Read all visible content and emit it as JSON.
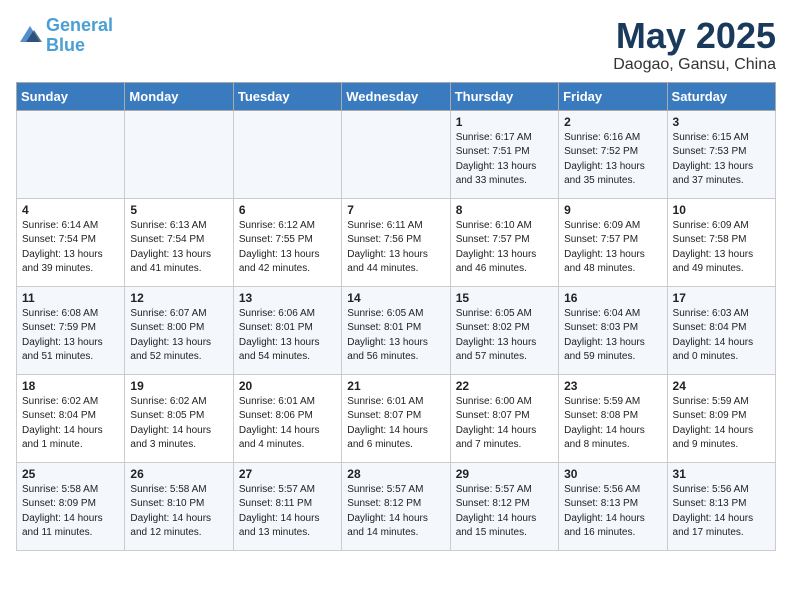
{
  "logo": {
    "line1": "General",
    "line2": "Blue"
  },
  "title": "May 2025",
  "subtitle": "Daogao, Gansu, China",
  "days_of_week": [
    "Sunday",
    "Monday",
    "Tuesday",
    "Wednesday",
    "Thursday",
    "Friday",
    "Saturday"
  ],
  "weeks": [
    [
      {
        "day": "",
        "info": ""
      },
      {
        "day": "",
        "info": ""
      },
      {
        "day": "",
        "info": ""
      },
      {
        "day": "",
        "info": ""
      },
      {
        "day": "1",
        "info": "Sunrise: 6:17 AM\nSunset: 7:51 PM\nDaylight: 13 hours\nand 33 minutes."
      },
      {
        "day": "2",
        "info": "Sunrise: 6:16 AM\nSunset: 7:52 PM\nDaylight: 13 hours\nand 35 minutes."
      },
      {
        "day": "3",
        "info": "Sunrise: 6:15 AM\nSunset: 7:53 PM\nDaylight: 13 hours\nand 37 minutes."
      }
    ],
    [
      {
        "day": "4",
        "info": "Sunrise: 6:14 AM\nSunset: 7:54 PM\nDaylight: 13 hours\nand 39 minutes."
      },
      {
        "day": "5",
        "info": "Sunrise: 6:13 AM\nSunset: 7:54 PM\nDaylight: 13 hours\nand 41 minutes."
      },
      {
        "day": "6",
        "info": "Sunrise: 6:12 AM\nSunset: 7:55 PM\nDaylight: 13 hours\nand 42 minutes."
      },
      {
        "day": "7",
        "info": "Sunrise: 6:11 AM\nSunset: 7:56 PM\nDaylight: 13 hours\nand 44 minutes."
      },
      {
        "day": "8",
        "info": "Sunrise: 6:10 AM\nSunset: 7:57 PM\nDaylight: 13 hours\nand 46 minutes."
      },
      {
        "day": "9",
        "info": "Sunrise: 6:09 AM\nSunset: 7:57 PM\nDaylight: 13 hours\nand 48 minutes."
      },
      {
        "day": "10",
        "info": "Sunrise: 6:09 AM\nSunset: 7:58 PM\nDaylight: 13 hours\nand 49 minutes."
      }
    ],
    [
      {
        "day": "11",
        "info": "Sunrise: 6:08 AM\nSunset: 7:59 PM\nDaylight: 13 hours\nand 51 minutes."
      },
      {
        "day": "12",
        "info": "Sunrise: 6:07 AM\nSunset: 8:00 PM\nDaylight: 13 hours\nand 52 minutes."
      },
      {
        "day": "13",
        "info": "Sunrise: 6:06 AM\nSunset: 8:01 PM\nDaylight: 13 hours\nand 54 minutes."
      },
      {
        "day": "14",
        "info": "Sunrise: 6:05 AM\nSunset: 8:01 PM\nDaylight: 13 hours\nand 56 minutes."
      },
      {
        "day": "15",
        "info": "Sunrise: 6:05 AM\nSunset: 8:02 PM\nDaylight: 13 hours\nand 57 minutes."
      },
      {
        "day": "16",
        "info": "Sunrise: 6:04 AM\nSunset: 8:03 PM\nDaylight: 13 hours\nand 59 minutes."
      },
      {
        "day": "17",
        "info": "Sunrise: 6:03 AM\nSunset: 8:04 PM\nDaylight: 14 hours\nand 0 minutes."
      }
    ],
    [
      {
        "day": "18",
        "info": "Sunrise: 6:02 AM\nSunset: 8:04 PM\nDaylight: 14 hours\nand 1 minute."
      },
      {
        "day": "19",
        "info": "Sunrise: 6:02 AM\nSunset: 8:05 PM\nDaylight: 14 hours\nand 3 minutes."
      },
      {
        "day": "20",
        "info": "Sunrise: 6:01 AM\nSunset: 8:06 PM\nDaylight: 14 hours\nand 4 minutes."
      },
      {
        "day": "21",
        "info": "Sunrise: 6:01 AM\nSunset: 8:07 PM\nDaylight: 14 hours\nand 6 minutes."
      },
      {
        "day": "22",
        "info": "Sunrise: 6:00 AM\nSunset: 8:07 PM\nDaylight: 14 hours\nand 7 minutes."
      },
      {
        "day": "23",
        "info": "Sunrise: 5:59 AM\nSunset: 8:08 PM\nDaylight: 14 hours\nand 8 minutes."
      },
      {
        "day": "24",
        "info": "Sunrise: 5:59 AM\nSunset: 8:09 PM\nDaylight: 14 hours\nand 9 minutes."
      }
    ],
    [
      {
        "day": "25",
        "info": "Sunrise: 5:58 AM\nSunset: 8:09 PM\nDaylight: 14 hours\nand 11 minutes."
      },
      {
        "day": "26",
        "info": "Sunrise: 5:58 AM\nSunset: 8:10 PM\nDaylight: 14 hours\nand 12 minutes."
      },
      {
        "day": "27",
        "info": "Sunrise: 5:57 AM\nSunset: 8:11 PM\nDaylight: 14 hours\nand 13 minutes."
      },
      {
        "day": "28",
        "info": "Sunrise: 5:57 AM\nSunset: 8:12 PM\nDaylight: 14 hours\nand 14 minutes."
      },
      {
        "day": "29",
        "info": "Sunrise: 5:57 AM\nSunset: 8:12 PM\nDaylight: 14 hours\nand 15 minutes."
      },
      {
        "day": "30",
        "info": "Sunrise: 5:56 AM\nSunset: 8:13 PM\nDaylight: 14 hours\nand 16 minutes."
      },
      {
        "day": "31",
        "info": "Sunrise: 5:56 AM\nSunset: 8:13 PM\nDaylight: 14 hours\nand 17 minutes."
      }
    ]
  ]
}
